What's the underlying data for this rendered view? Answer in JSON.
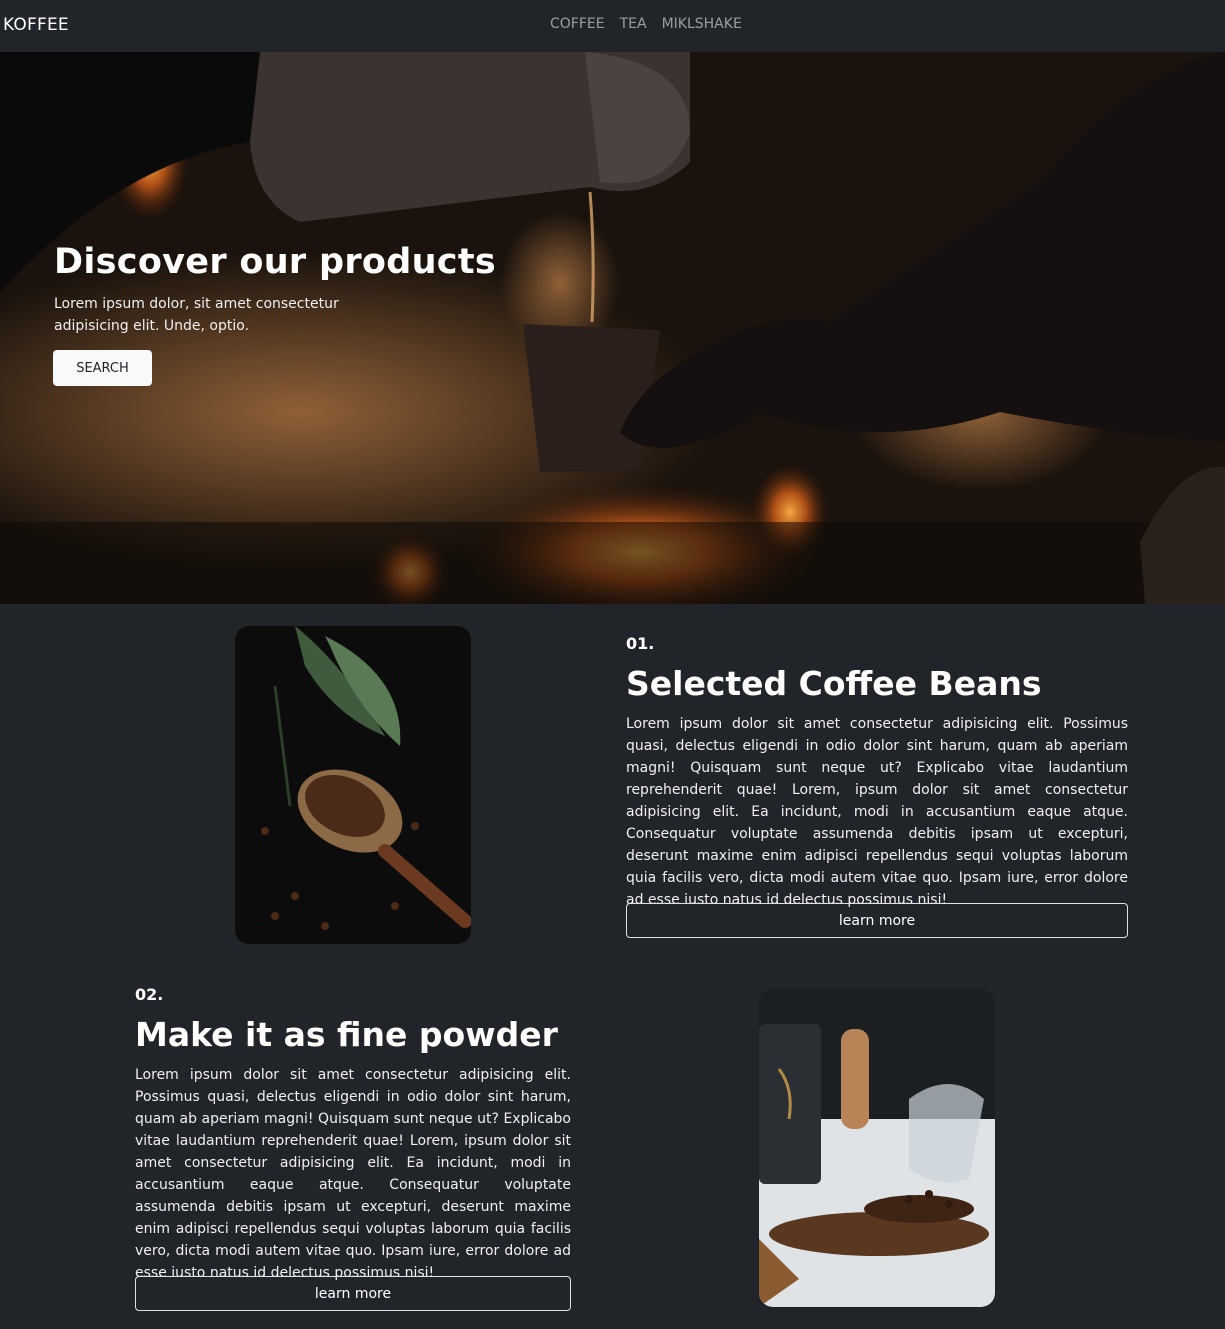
{
  "nav": {
    "brand": "KOFFEE",
    "links": [
      "COFFEE",
      "TEA",
      "MIKLSHAKE"
    ]
  },
  "hero": {
    "title": "Discover our products",
    "text": "Lorem ipsum dolor, sit amet consectetur adipisicing elit. Unde, optio.",
    "button": "SEARCH"
  },
  "features": [
    {
      "number": "01.",
      "title": "Selected Coffee Beans",
      "body": "Lorem ipsum dolor sit amet consectetur adipisicing elit. Possimus quasi, delectus eligendi in odio dolor sint harum, quam ab aperiam magni! Quisquam sunt neque ut? Explicabo vitae laudantium reprehenderit quae! Lorem, ipsum dolor sit amet consectetur adipisicing elit. Ea incidunt, modi in accusantium eaque atque. Consequatur voluptate assumenda debitis ipsam ut excepturi, deserunt maxime enim adipisci repellendus sequi voluptas laborum quia facilis vero, dicta modi autem vitae quo. Ipsam iure, error dolore ad esse iusto natus id delectus possimus nisi!",
      "button": "learn more"
    },
    {
      "number": "02.",
      "title": "Make it as fine powder",
      "body": "Lorem ipsum dolor sit amet consectetur adipisicing elit. Possimus quasi, delectus eligendi in odio dolor sint harum, quam ab aperiam magni! Quisquam sunt neque ut? Explicabo vitae laudantium reprehenderit quae! Lorem, ipsum dolor sit amet consectetur adipisicing elit. Ea incidunt, modi in accusantium eaque atque. Consequatur voluptate assumenda debitis ipsam ut excepturi, deserunt maxime enim adipisci repellendus sequi voluptas laborum quia facilis vero, dicta modi autem vitae quo. Ipsam iure, error dolore ad esse iusto natus id delectus possimus nisi!",
      "button": "learn more"
    }
  ],
  "colors": {
    "background": "#212529",
    "text": "#ffffff",
    "button_light": "#f8f9fa"
  }
}
